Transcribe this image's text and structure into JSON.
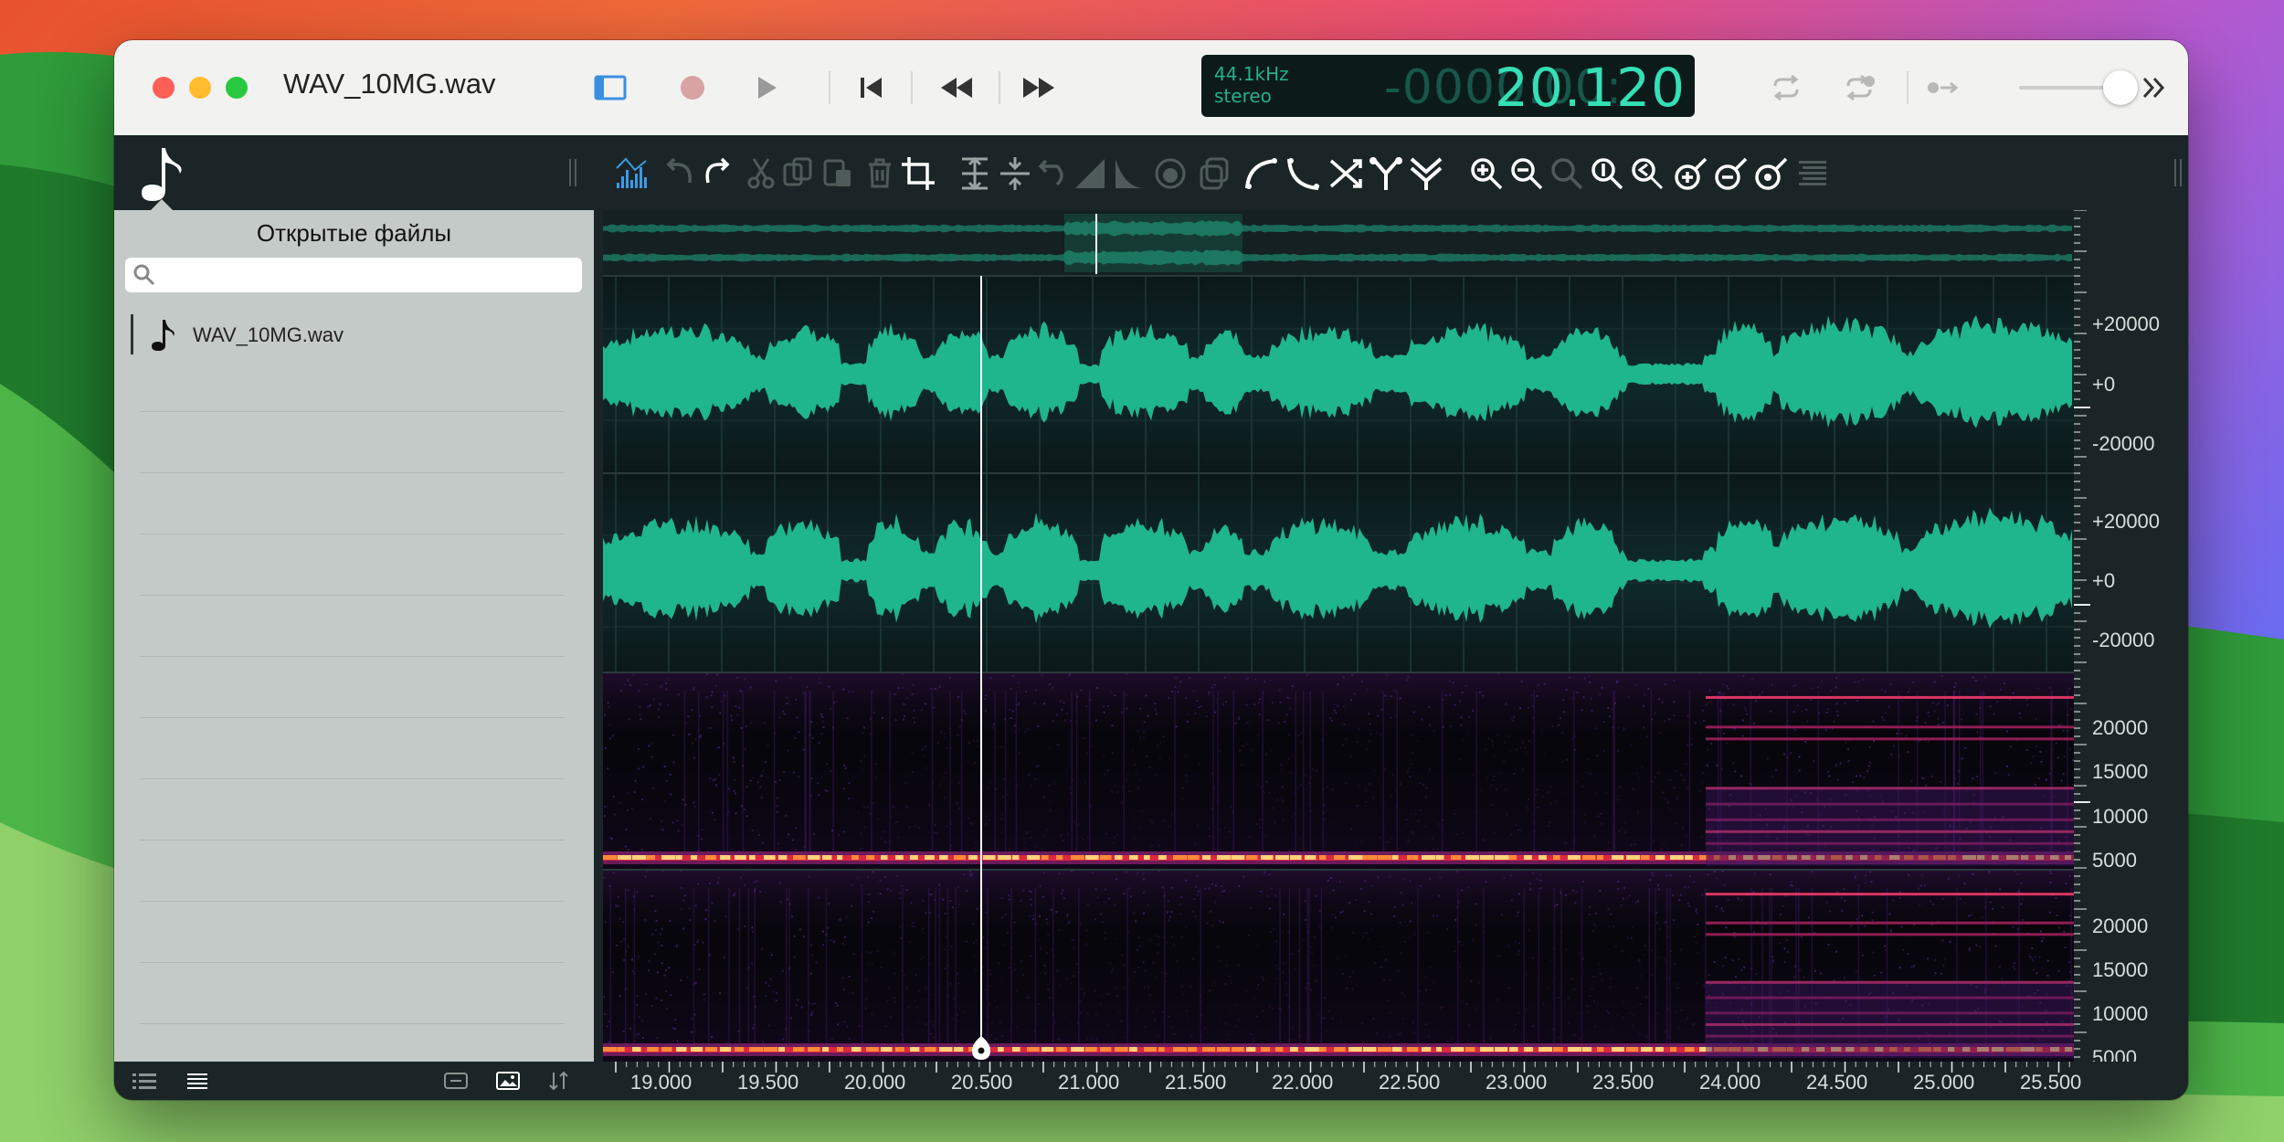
{
  "window": {
    "title": "WAV_10MG.wav"
  },
  "lcd": {
    "rate": "44.1kHz",
    "channels": "stereo",
    "time_dim": "-0000:00:",
    "time_bright": "20.120"
  },
  "sidebar": {
    "title": "Открытые файлы",
    "search_placeholder": "",
    "files": [
      {
        "name": "WAV_10MG.wav"
      }
    ]
  },
  "ruler": {
    "wave1": [
      "+20000",
      "+0",
      "-20000"
    ],
    "wave2": [
      "+20000",
      "+0",
      "-20000"
    ],
    "spec1": [
      "20000",
      "15000",
      "10000",
      "5000"
    ],
    "spec2": [
      "20000",
      "15000",
      "10000",
      "5000"
    ]
  },
  "timeline": {
    "ticks": [
      "19.000",
      "19.500",
      "20.000",
      "20.500",
      "21.000",
      "21.500",
      "22.000",
      "22.500",
      "23.000",
      "23.500",
      "24.000",
      "24.500",
      "25.000",
      "25.500"
    ]
  },
  "colors": {
    "waveform": "#1fb58d",
    "lcd_bright": "#34e0b4",
    "accent": "#3b8fe0"
  }
}
